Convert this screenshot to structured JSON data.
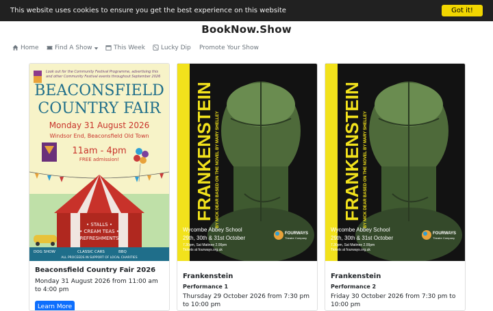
{
  "cookie": {
    "message": "This website uses cookies to ensure you get the best experience on this website",
    "button": "Got it!"
  },
  "brand": "BookNow.Show",
  "nav": [
    {
      "label": "Home",
      "icon": "home-icon"
    },
    {
      "label": "Find A Show",
      "icon": "ticket-icon"
    },
    {
      "label": "This Week",
      "icon": "calendar-icon"
    },
    {
      "label": "Lucky Dip",
      "icon": "dice-icon"
    },
    {
      "label": "Promote Your Show",
      "icon": ""
    }
  ],
  "cards": [
    {
      "title": "Beaconsfield Country Fair 2026",
      "subtitle": "",
      "date": "Monday 31 August 2026 from 11:00 am to 4:00 pm",
      "button": "Learn More",
      "poster": {
        "promo": "Look out for the Community Festival Programme, advertising this and other Community Festival events throughout September 2026",
        "line1": "BEACONSFIELD",
        "line2": "COUNTRY FAIR",
        "date": "Monday 31 August 2026",
        "venue": "Windsor End, Beaconsfield Old Town",
        "time": "11am - 4pm",
        "admission": "FREE admission!",
        "stalls": "• STALLS •",
        "teas": "• CREAM TEAS •",
        "refreshments": "REFRESHMENTS",
        "dog": "DOG SHOW",
        "cars": "CLASSIC CARS",
        "bbq": "BBQ",
        "proceeds": "ALL PROCEEDS IN SUPPORT OF LOCAL CHARITIES"
      }
    },
    {
      "title": "Frankenstein",
      "subtitle": "Performance 1",
      "date": "Thursday 29 October 2026 from 7:30 pm to 10:00 pm",
      "button": "",
      "poster": {
        "title": "FRANKENSTEIN",
        "byline": "BY NICK DEAR BASED ON THE NOVEL BY MARY SHELLEY",
        "venue": "Wycombe Abbey School",
        "dates": "29th, 30th & 31st October",
        "times": "7.30pm, Sat Matinee 2.00pm",
        "tickets": "Tickets at fourways.org.uk",
        "company": "FOURWAYS",
        "company_sub": "Theatre Company"
      }
    },
    {
      "title": "Frankenstein",
      "subtitle": "Performance 2",
      "date": "Friday 30 October 2026 from 7:30 pm to 10:00 pm",
      "button": "",
      "poster": {
        "title": "FRANKENSTEIN",
        "byline": "BY NICK DEAR BASED ON THE NOVEL BY MARY SHELLEY",
        "venue": "Wycombe Abbey School",
        "dates": "29th, 30th & 31st October",
        "times": "7.30pm, Sat Matinee 2.00pm",
        "tickets": "Tickets at fourways.org.uk",
        "company": "FOURWAYS",
        "company_sub": "Theatre Company"
      }
    }
  ],
  "colors": {
    "accent": "#0d6efd",
    "cookie_bg": "#212121",
    "cookie_button": "#f1d600",
    "frank_yellow": "#f2e21c"
  }
}
